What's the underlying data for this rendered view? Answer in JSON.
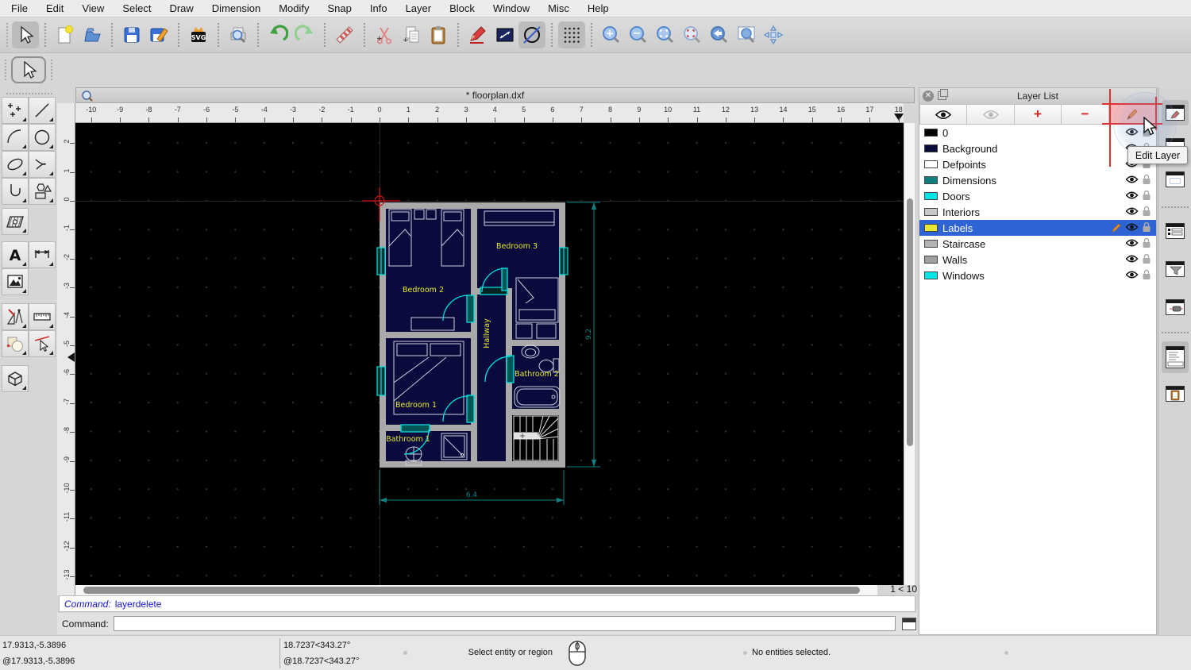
{
  "menu": {
    "items": [
      "File",
      "Edit",
      "View",
      "Select",
      "Draw",
      "Dimension",
      "Modify",
      "Snap",
      "Info",
      "Layer",
      "Block",
      "Window",
      "Misc",
      "Help"
    ]
  },
  "document": {
    "title": "* floorplan.dxf",
    "zoom_indicator": "1 < 10"
  },
  "toolbar": {
    "buttons": [
      "selection-arrow",
      "new-document",
      "open-file",
      "save",
      "save-as",
      "export-svg",
      "print-preview",
      "undo",
      "redo",
      "delete",
      "cut",
      "copy",
      "paste",
      "draw-order",
      "distance",
      "isometric-circle",
      "grid-toggle",
      "zoom-in",
      "zoom-out",
      "zoom-auto",
      "zoom-previous",
      "zoom-back",
      "zoom-window",
      "zoom-pan"
    ]
  },
  "left_toolbar": {
    "tools": [
      "points",
      "line",
      "arc",
      "circle",
      "ellipse",
      "spline",
      "polyline",
      "polygon",
      "hatch",
      "text",
      "dimension",
      "image",
      "misc-draw",
      "measure",
      "order",
      "modify-attributes",
      "3d-box"
    ]
  },
  "rulers": {
    "horizontal": [
      -10,
      -9,
      -8,
      -7,
      -6,
      -5,
      -4,
      -3,
      -2,
      -1,
      0,
      1,
      2,
      3,
      4,
      5,
      6,
      7,
      8,
      9,
      10,
      11,
      12,
      13,
      14,
      15,
      16,
      17,
      18
    ],
    "vertical": [
      2,
      1,
      0,
      -1,
      -2,
      -3,
      -4,
      -5,
      -6,
      -7,
      -8,
      -9,
      -10,
      -11,
      -12,
      -13
    ]
  },
  "floorplan": {
    "labels": {
      "bedroom1": "Bedroom 1",
      "bedroom2": "Bedroom 2",
      "bedroom3": "Bedroom 3",
      "hallway": "Hallway",
      "bathroom1": "Bathroom 1",
      "bathroom2": "Bathroom 2"
    },
    "dimensions": {
      "width": "6.4",
      "height": "9.2"
    },
    "colors": {
      "walls": "#a9a9a9",
      "interior": "#0a0a3c",
      "labels": "#e8e832",
      "doors": "#00e0e0",
      "dimensions": "#0d8585",
      "origin_marker": "#cc1111"
    }
  },
  "layer_list": {
    "title": "Layer List",
    "tooltip": "Edit Layer",
    "selected_color": "#2e63d4",
    "layers": [
      {
        "name": "0",
        "color": "#000000",
        "selected": false,
        "editing": false
      },
      {
        "name": "Background",
        "color": "#0a0a38",
        "selected": false,
        "editing": false
      },
      {
        "name": "Defpoints",
        "color": "#ffffff",
        "selected": false,
        "editing": false
      },
      {
        "name": "Dimensions",
        "color": "#0e8080",
        "selected": false,
        "editing": false
      },
      {
        "name": "Doors",
        "color": "#00e5e5",
        "selected": false,
        "editing": false
      },
      {
        "name": "Interiors",
        "color": "#c8c8c8",
        "selected": false,
        "editing": false
      },
      {
        "name": "Labels",
        "color": "#e8e832",
        "selected": true,
        "editing": true
      },
      {
        "name": "Staircase",
        "color": "#b4b4b4",
        "selected": false,
        "editing": false
      },
      {
        "name": "Walls",
        "color": "#a0a0a0",
        "selected": false,
        "editing": false
      },
      {
        "name": "Windows",
        "color": "#00e5e5",
        "selected": false,
        "editing": false
      }
    ]
  },
  "command": {
    "history_label": "Command:",
    "history_value": "layerdelete",
    "prompt_label": "Command:",
    "input_value": ""
  },
  "status_bar": {
    "abs_coord": "17.9313,-5.3896",
    "rel_coord": "@17.9313,-5.3896",
    "abs_polar": "18.7237<343.27°",
    "rel_polar": "@18.7237<343.27°",
    "hint": "Select entity or region",
    "selection": "No entities selected."
  }
}
